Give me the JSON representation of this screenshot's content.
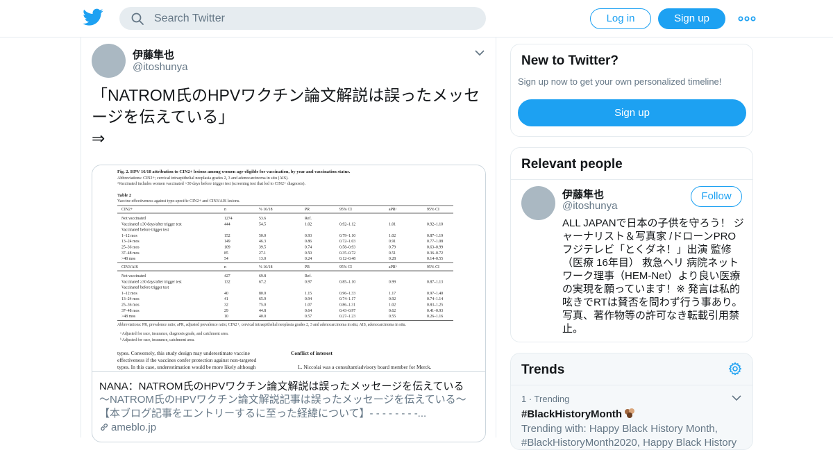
{
  "header": {
    "search_placeholder": "Search Twitter",
    "login_label": "Log in",
    "signup_label": "Sign up"
  },
  "tweet": {
    "author_name": "伊藤隼也",
    "author_handle": "@itoshunya",
    "text": "「NATROM氏のHPVワクチン論文解説は誤ったメッセージを伝えている」\n⇒",
    "card": {
      "title": "NANA：NATROM氏のHPVワクチン論文解説は誤ったメッセージを伝えている",
      "description": "～NATROM氏のHPVワクチン論文解説記事は誤ったメッセージを伝えている～【本ブログ記事をエントリーするに至った経緯について】- - - - - - - -...",
      "domain": "ameblo.jp",
      "image_text": {
        "fig_caption": "Fig. 2.  HPV 16/18 attribution to CIN2+ lesions among women age-eligible for vaccination, by year and vaccination status.",
        "fig_abbrev": "Abbreviations: CIN2+; cervical intraepithelial neoplasia grades 2, 3 and adenocarcinoma in situ (AIS).",
        "fig_note": "ᵃVaccinated includes women vaccinated >30 days before trigger test (screening test that led to CIN2+ diagnosis).",
        "table_title": "Table 2",
        "table_subtitle": "Vaccine effectiveness against type-specific CIN2+ and CIN3/AIS lesions.",
        "headers_1": [
          "CIN2+",
          "n",
          "% 16/18",
          "PR",
          "95% CI",
          "aPRᵃ",
          "95% CI"
        ],
        "rows_1": [
          [
            "Not vaccinated",
            "1274",
            "53.6",
            "Ref.",
            "",
            "",
            ""
          ],
          [
            "Vaccinated ≥30 days/after trigger test",
            "444",
            "54.5",
            "1.02",
            "0.92–1.12",
            "1.01",
            "0.92–1.10"
          ],
          [
            "Vaccinated before trigger test",
            "",
            "",
            "",
            "",
            "",
            ""
          ],
          [
            "  1–12 mos",
            "152",
            "50.0",
            "0.93",
            "0.79–1.10",
            "1.02",
            "0.87–1.19"
          ],
          [
            "  13–24 mos",
            "149",
            "46.3",
            "0.86",
            "0.72–1.03",
            "0.91",
            "0.77–1.08"
          ],
          [
            "  25–36 mos",
            "109",
            "39.5",
            "0.74",
            "0.58–0.93",
            "0.79",
            "0.63–0.99"
          ],
          [
            "  37–48 mos",
            "85",
            "27.1",
            "0.50",
            "0.35–0.72",
            "0.51",
            "0.36–0.72"
          ],
          [
            "  >48 mos",
            "54",
            "13.0",
            "0.24",
            "0.12–0.48",
            "0.28",
            "0.14–0.55"
          ]
        ],
        "headers_2": [
          "CIN3/AIS",
          "n",
          "% 16/18",
          "PR",
          "95% CI",
          "aPRᵇ",
          "95% CI"
        ],
        "rows_2": [
          [
            "Not vaccinated",
            "427",
            "69.8",
            "Ref.",
            "",
            "",
            ""
          ],
          [
            "Vaccinated ≥30 days/after trigger test",
            "132",
            "67.2",
            "0.97",
            "0.85–1.10",
            "0.99",
            "0.87–1.13"
          ],
          [
            "Vaccinated before trigger test",
            "",
            "",
            "",
            "",
            "",
            ""
          ],
          [
            "  1–12 mos",
            "40",
            "80.0",
            "1.15",
            "0.96–1.33",
            "1.17",
            "0.97–1.40"
          ],
          [
            "  13–24 mos",
            "41",
            "65.9",
            "0.94",
            "0.74–1.17",
            "0.92",
            "0.74–1.14"
          ],
          [
            "  25–36 mos",
            "32",
            "75.0",
            "1.07",
            "0.86–1.31",
            "1.02",
            "0.83–1.25"
          ],
          [
            "  37–48 mos",
            "29",
            "44.8",
            "0.64",
            "0.43–0.97",
            "0.62",
            "0.41–0.93"
          ],
          [
            "  >48 mos",
            "10",
            "40.0",
            "0.57",
            "0.27–1.23",
            "0.55",
            "0.26–1.16"
          ]
        ],
        "table_abbrev": "Abbreviations: PR, prevalence ratio; aPR, adjusted prevalence ratio; CIN2+, cervical intraepithelial neoplasia grades 2, 3 and adenocarcinoma in situ; AIS, adenocarcinoma in situ.",
        "note_a": "ᵃ  Adjusted for race, insurance, diagnosis grade, and catchment area.",
        "note_b": "ᵇ  Adjusted for race, insurance, catchment area.",
        "body_left_1": "types. Conversely, this study design may underestimate vaccine",
        "body_left_2": "effectiveness if the vaccines confer protection against non-targeted",
        "body_left_3": "types. In this case, underestimation would be more likely although",
        "coi_heading": "Conflict of interest",
        "coi_text": "L. Niccolai was a consultant/advisory board member for Merck."
      }
    }
  },
  "sidebar": {
    "new_to_twitter": {
      "title": "New to Twitter?",
      "subtitle": "Sign up now to get your own personalized timeline!",
      "button": "Sign up"
    },
    "relevant_people": {
      "title": "Relevant people",
      "name": "伊藤隼也",
      "handle": "@itoshunya",
      "follow_label": "Follow",
      "bio": "ALL JAPANで日本の子供を守ろう！ ジャーナリスト＆写真家 /ドローンPRO フジテレビ「とくダネ！」出演 監修（医療 16年目） 救急ヘリ 病院ネットワーク理事（HEM-Net）より良い医療の実現を願っています！※ 発言は私的呟きでRTは賛否を問わず行う事あり。写真、著作物等の許可なき転載引用禁止。"
    },
    "trends": {
      "title": "Trends",
      "items": [
        {
          "meta": "1 · Trending",
          "tag": "#BlackHistoryMonth",
          "with": "Trending with: Happy Black History Month, #BlackHistoryMonth2020, Happy Black History"
        }
      ]
    }
  },
  "colors": {
    "brand": "#1da1f2",
    "text": "#14171a",
    "secondary": "#657786",
    "border": "#e6ecf0"
  }
}
